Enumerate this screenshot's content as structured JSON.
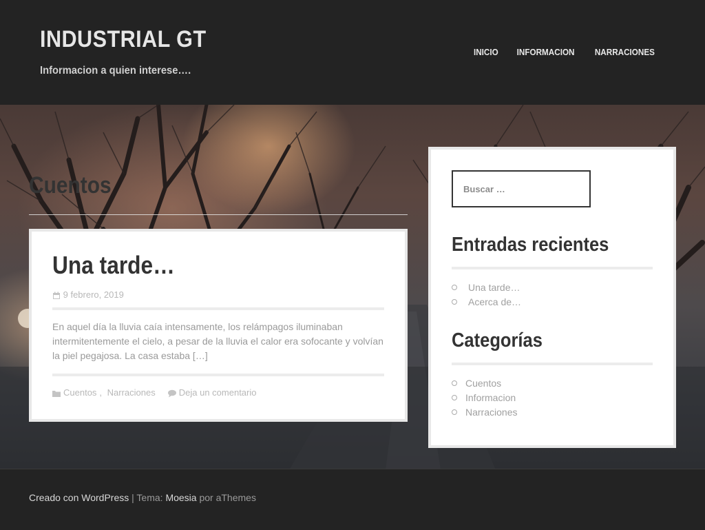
{
  "site": {
    "title": "INDUSTRIAL GT",
    "description": "Informacion a quien interese…."
  },
  "nav": {
    "items": [
      {
        "label": "INICIO"
      },
      {
        "label": "INFORMACION"
      },
      {
        "label": "NARRACIONES"
      }
    ]
  },
  "archive": {
    "title": "Cuentos"
  },
  "post": {
    "title": "Una tarde…",
    "date": "9 febrero, 2019",
    "excerpt": "En aquel día la lluvia caía intensamente, los relámpagos iluminaban intermitentemente el cielo, a pesar de la lluvia el calor era sofocante y volvían la piel pegajosa. La casa estaba […]",
    "category_1": "Cuentos",
    "category_sep": ", ",
    "category_2": "Narraciones",
    "comment_link": "Deja un comentario",
    "icons": {
      "date": "calendar-icon",
      "category": "folder-icon",
      "comment": "comment-icon"
    }
  },
  "sidebar": {
    "search_placeholder": "Buscar …",
    "recent": {
      "title": "Entradas recientes",
      "items": [
        "Una tarde…",
        "Acerca de…"
      ]
    },
    "categories": {
      "title": "Categorías",
      "items": [
        "Cuentos",
        "Informacion",
        "Narraciones"
      ]
    }
  },
  "footer": {
    "created_with": "Creado con WordPress",
    "separator": " | Tema: ",
    "theme": "Moesia",
    "by": " por aThemes"
  },
  "colors": {
    "header_bg": "#232323",
    "card_bg": "#ffffff",
    "text_dark": "#333333",
    "text_muted": "#9a9a9a"
  }
}
